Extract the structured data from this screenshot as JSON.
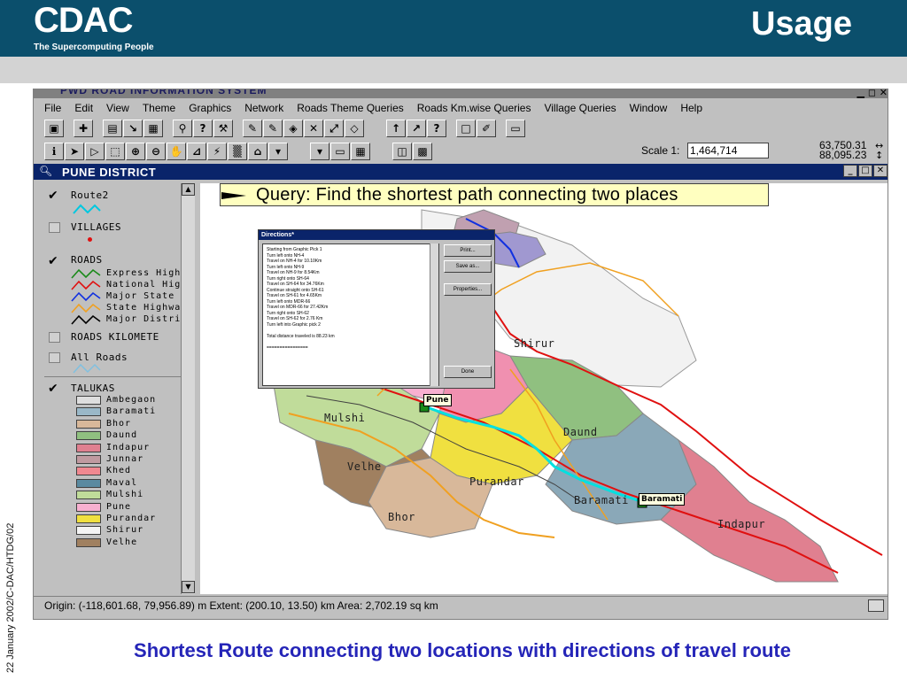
{
  "slide": {
    "logo_text": "CDAC",
    "logo_tagline": "The Supercomputing People",
    "title": "Usage",
    "side_caption": "22 January 2002/C-DAC/HTDG/02",
    "caption": "Shortest Route connecting two locations with directions of travel route"
  },
  "app": {
    "title": "PWD ROAD INFORMATION SYSTEM",
    "menu": [
      "File",
      "Edit",
      "View",
      "Theme",
      "Graphics",
      "Network",
      "Roads Theme Queries",
      "Roads Km.wise Queries",
      "Village Queries",
      "Window",
      "Help"
    ],
    "scale_label": "Scale 1:",
    "scale_value": "1,464,714",
    "coord_x": "63,750.31",
    "coord_y": "88,095.23",
    "status": "Origin: (-118,601.68, 79,956.89) m  Extent: (200.10, 13.50) km  Area: 2,702.19 sq km"
  },
  "document": {
    "title": "PUNE DISTRICT",
    "query": "Query: Find the shortest path connecting two places"
  },
  "legend": {
    "route": "Route2",
    "villages": "VILLAGES",
    "roads": "ROADS",
    "road_types": [
      {
        "label": "Express High",
        "color": "#1a8a1a"
      },
      {
        "label": "National High",
        "color": "#e01010"
      },
      {
        "label": "Major State H",
        "color": "#1030e0"
      },
      {
        "label": "State Highwa",
        "color": "#f0a020"
      },
      {
        "label": "Major District",
        "color": "#000000"
      }
    ],
    "roads_km": "ROADS KILOMETE",
    "all_roads": "All Roads",
    "talukas": "TALUKAS",
    "taluka_items": [
      {
        "label": "Ambegaon",
        "color": "#dedede"
      },
      {
        "label": "Baramati",
        "color": "#9ab8c8"
      },
      {
        "label": "Bhor",
        "color": "#d8b89a"
      },
      {
        "label": "Daund",
        "color": "#90c080"
      },
      {
        "label": "Indapur",
        "color": "#e08090"
      },
      {
        "label": "Junnar",
        "color": "#c09aa0"
      },
      {
        "label": "Khed",
        "color": "#f08890"
      },
      {
        "label": "Maval",
        "color": "#5a8aa0"
      },
      {
        "label": "Mulshi",
        "color": "#c0dc9a"
      },
      {
        "label": "Pune",
        "color": "#f8b0d0"
      },
      {
        "label": "Purandar",
        "color": "#f0e040"
      },
      {
        "label": "Shirur",
        "color": "#f4f4f4"
      },
      {
        "label": "Velhe",
        "color": "#a08060"
      }
    ]
  },
  "directions": {
    "title": "Directions*",
    "lines": [
      "Starting from Graphic Pick 1",
      "Turn left onto NH-4",
      "Travel on NH-4 for 10.10Km",
      "Turn left onto NH-9",
      "Travel on NH-9 for 8.54Km",
      "Turn right onto SH-64",
      "Travel on SH-64 for 34.76Km",
      "Continue straight onto SH-61",
      "Travel on SH-61 for 4.65Km",
      "Turn left onto MDR-66",
      "Travel on MDR-66 for 27.42Km",
      "Turn right onto SH-62",
      "Travel on SH-62 for 2.76 Km",
      "Turn left into Graphic pick 2",
      "",
      "Total distance traveled is 88.23 km",
      "",
      "================"
    ],
    "buttons": {
      "print": "Print...",
      "save": "Save as...",
      "properties": "Properties...",
      "done": "Done"
    }
  },
  "map": {
    "labels": {
      "shirur": "Shirur",
      "mulshi": "Mulshi",
      "daund": "Daund",
      "velhe": "Velhe",
      "purandar": "Purandar",
      "baramati": "Baramati",
      "bhor": "Bhor",
      "indapur": "Indapur"
    },
    "callout_pune": "Pune",
    "callout_baramati": "Baramati"
  },
  "colors": {
    "header_band": "#0b4f6c",
    "caption": "#2525b8",
    "route": "#00e0e0",
    "point": "#1a8a1a"
  }
}
